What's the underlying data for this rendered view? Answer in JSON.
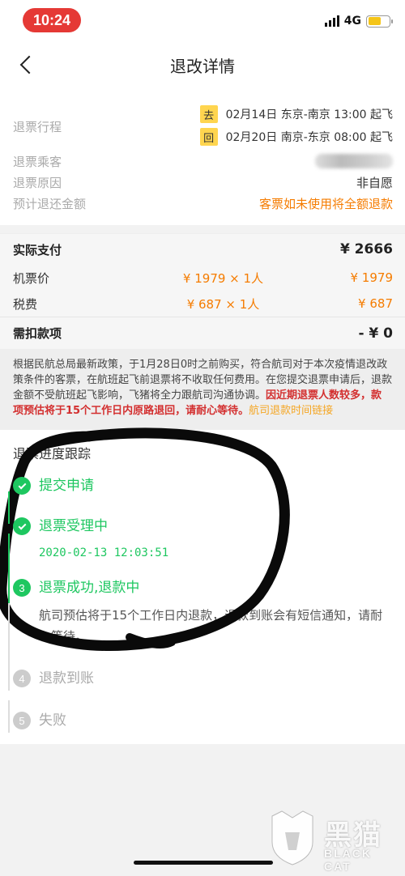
{
  "status_bar": {
    "time": "10:24",
    "network": "4G",
    "battery_level": 0.6
  },
  "nav": {
    "title": "退改详情"
  },
  "refund_info": {
    "trip_label": "退票行程",
    "legs": [
      {
        "tag": "去",
        "text": "02月14日 东京-南京 13:00 起飞"
      },
      {
        "tag": "回",
        "text": "02月20日 南京-东京 08:00 起飞"
      }
    ],
    "passenger_label": "退票乘客",
    "reason_label": "退票原因",
    "reason_value": "非自愿",
    "amount_label": "预计退还金额",
    "amount_value": "客票如未使用将全额退款"
  },
  "payment": {
    "total_label": "实际支付",
    "total_value": "¥ 2666",
    "fare_label": "机票价",
    "fare_detail": "¥ 1979 × 1人",
    "fare_value": "¥ 1979",
    "tax_label": "税费",
    "tax_detail": "¥ 687 × 1人",
    "tax_value": "¥ 687",
    "deduct_label": "需扣款项",
    "deduct_value": "- ¥ 0"
  },
  "notice": {
    "text": "根据民航总局最新政策，于1月28日0时之前购买，符合航司对于本次疫情退改政策条件的客票，在航班起飞前退票将不收取任何费用。在您提交退票申请后，退款金额不受航班起飞影响，飞猪将全力跟航司沟通协调。",
    "warning": "因近期退票人数较多，款项预估将于15个工作日内原路退回，请耐心等待。",
    "link": "航司退款时间链接"
  },
  "progress": {
    "title": "退票进度跟踪",
    "steps": [
      {
        "index": "1",
        "label": "提交申请",
        "state": "done"
      },
      {
        "index": "2",
        "label": "退票受理中",
        "state": "done",
        "time": "2020-02-13 12:03:51"
      },
      {
        "index": "3",
        "label": "退票成功,退款中",
        "state": "active",
        "desc": "航司预估将于15个工作日内退款，退款到账会有短信通知，请耐心等待。"
      },
      {
        "index": "4",
        "label": "退款到账",
        "state": "todo"
      },
      {
        "index": "5",
        "label": "失败",
        "state": "todo"
      }
    ]
  },
  "watermark": {
    "text_cn": "黑猫",
    "text_en": "BLACK CAT"
  },
  "colors": {
    "accent_orange": "#f57c00",
    "success_green": "#1ec760",
    "warning_red": "#d32f2f",
    "status_red": "#e53935"
  }
}
